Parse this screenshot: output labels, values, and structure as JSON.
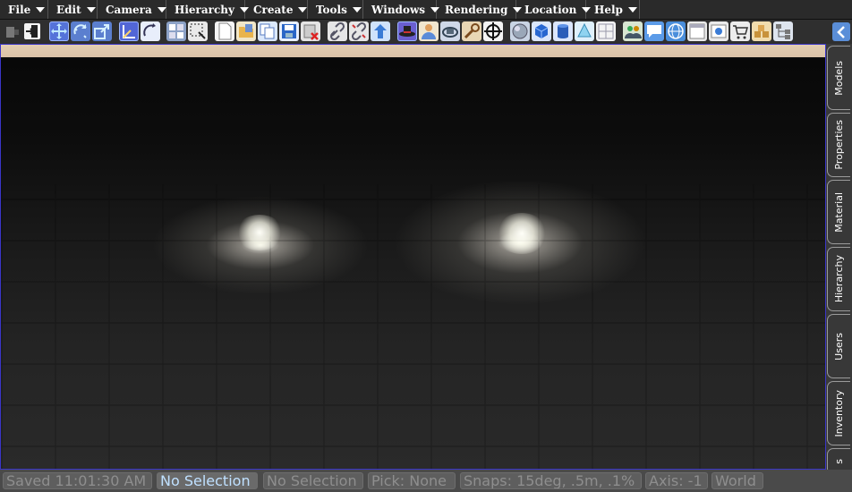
{
  "menubar": {
    "items": [
      {
        "label": "File"
      },
      {
        "label": "Edit"
      },
      {
        "label": "Camera"
      },
      {
        "label": "Hierarchy"
      },
      {
        "label": "Create"
      },
      {
        "label": "Tools"
      },
      {
        "label": "Windows"
      },
      {
        "label": "Rendering"
      },
      {
        "label": "Location"
      },
      {
        "label": "Help"
      }
    ]
  },
  "toolbar": {
    "icons": [
      "login-icon",
      "move-icon",
      "rotate-icon",
      "scale-icon",
      "axis-move-icon",
      "axis-rotate-icon",
      "select-box-icon",
      "select-dashed-icon",
      "new-document-icon",
      "open-file-icon",
      "copy-icon",
      "save-icon",
      "delete-icon",
      "link-icon",
      "unlink-icon",
      "parent-up-icon",
      "avatar-hat-icon",
      "avatar-person-icon",
      "camera-orbit-icon",
      "tools-wrench-icon",
      "crosshair-icon",
      "sphere-icon",
      "cube-icon",
      "cylinder-icon",
      "cone-icon",
      "plane-icon",
      "users-icon",
      "chat-icon",
      "globe-icon",
      "info-icon",
      "window-icon",
      "shopping-cart-icon",
      "inventory-boxes-icon",
      "hierarchy-graph-icon",
      "collapse-arrow-icon"
    ]
  },
  "sidetabs": [
    {
      "label": "Models"
    },
    {
      "label": "Properties"
    },
    {
      "label": "Material"
    },
    {
      "label": "Hierarchy"
    },
    {
      "label": "Users"
    },
    {
      "label": "Inventory"
    },
    {
      "label": "s"
    }
  ],
  "statusbar": {
    "saved": "Saved 11:01:30 AM",
    "selection": "No Selection",
    "selection2": "No Selection",
    "pick": "Pick: None",
    "snaps": "Snaps: 15deg, .5m, .1%",
    "axis": "Axis: -1",
    "space": "World"
  },
  "colors": {
    "viewport_border": "#3a35c8",
    "highlight_text": "#bfe0ff",
    "accent": "#5a8ed8"
  }
}
